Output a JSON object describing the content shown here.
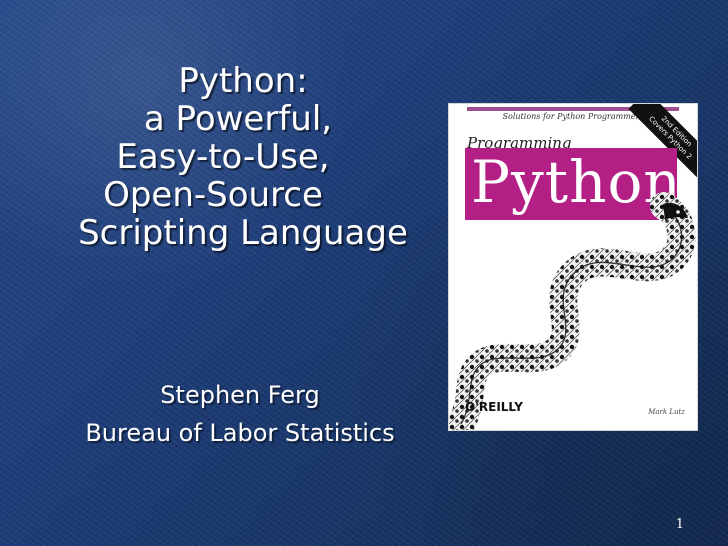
{
  "slide": {
    "title_lines": [
      "Python:",
      "a Powerful,",
      "Easy-to-Use,",
      "Open-Source",
      "Scripting Language"
    ],
    "author_lines": [
      "Stephen Ferg",
      "Bureau of Labor Statistics"
    ],
    "slide_number": "1"
  },
  "book_cover": {
    "series": "Solutions for Python Programmers",
    "edition_lines": [
      "2nd Edition",
      "Covers Python 2"
    ],
    "kicker": "Programming",
    "title": "Python",
    "publisher": "O'REILLY",
    "author": "Mark Lutz"
  },
  "colors": {
    "background_blue": "#1f3f7d",
    "cover_magenta": "#b41f86",
    "text_white": "#ffffff"
  },
  "icons": {
    "snake": "python-snake-illustration"
  }
}
